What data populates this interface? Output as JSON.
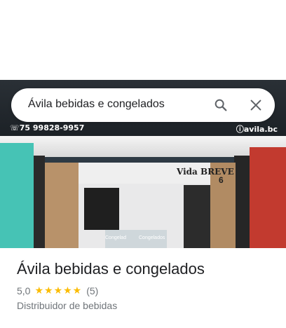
{
  "search": {
    "query": "Ávila bebidas e congelados"
  },
  "photo": {
    "sign_phone": "☏75 99828-9957",
    "sign_instagram": "ⓘavila.bc",
    "store_number": "6",
    "mural_text": "Vida BREVE",
    "fridge_labels": [
      "Congelad",
      "Congelados"
    ]
  },
  "place": {
    "name": "Ávila bebidas e congelados",
    "rating": "5,0",
    "stars": "★★★★★",
    "review_count": "(5)",
    "category": "Distribuidor de bebidas"
  }
}
